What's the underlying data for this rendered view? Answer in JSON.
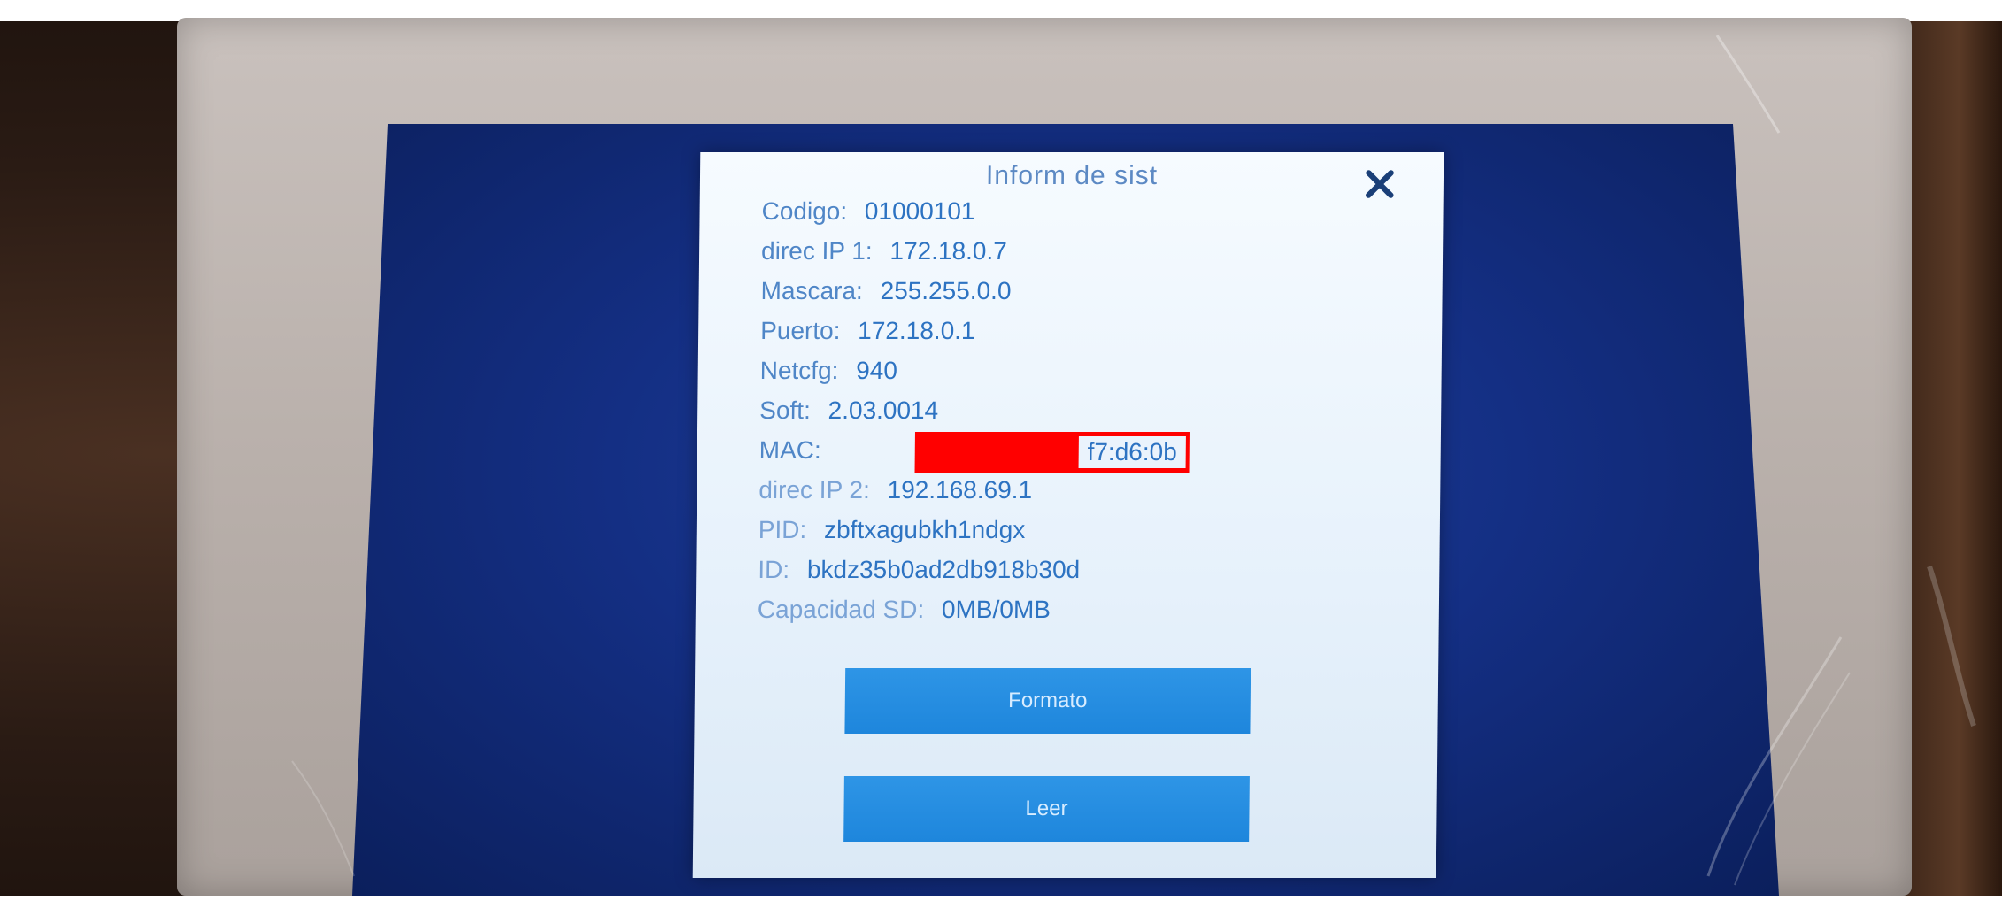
{
  "dialog": {
    "title": "Inform de sist",
    "close_icon": "close-icon"
  },
  "info": {
    "codigo": {
      "label": "Codigo:",
      "value": "01000101"
    },
    "direc_ip_1": {
      "label": "direc IP 1:",
      "value": "172.18.0.7"
    },
    "mascara": {
      "label": "Mascara:",
      "value": "255.255.0.0"
    },
    "puerto": {
      "label": "Puerto:",
      "value": "172.18.0.1"
    },
    "netcfg": {
      "label": "Netcfg:",
      "value": "940"
    },
    "soft": {
      "label": "Soft:",
      "value": "2.03.0014"
    },
    "mac": {
      "label": "MAC:",
      "value_visible": "f7:d6:0b"
    },
    "direc_ip_2": {
      "label": "direc IP 2:",
      "value": "192.168.69.1"
    },
    "pid": {
      "label": "PID:",
      "value": "zbftxagubkh1ndgx"
    },
    "id": {
      "label": "ID:",
      "value": "bkdz35b0ad2db918b30d"
    },
    "capacidad_sd": {
      "label": "Capacidad SD:",
      "value": "0MB/0MB"
    }
  },
  "buttons": {
    "formato": "Formato",
    "leer": "Leer"
  },
  "colors": {
    "screen_blue": "#142f84",
    "dialog_bg": "#eaf3fc",
    "text_blue": "#2d73c2",
    "button_blue": "#2488de",
    "redaction": "#ff0000"
  }
}
